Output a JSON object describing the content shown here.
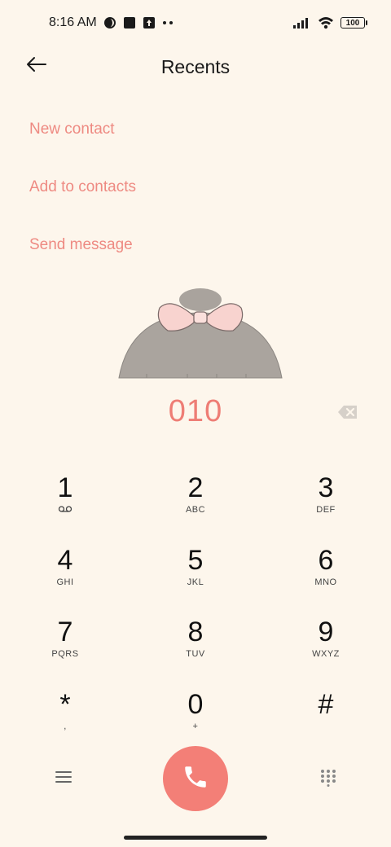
{
  "status_bar": {
    "time": "8:16 AM",
    "battery": "100",
    "icons": [
      "moon-icon",
      "square-icon",
      "upload-icon",
      "dots-icon",
      "signal-icon",
      "wifi-icon",
      "battery-icon"
    ]
  },
  "header": {
    "title": "Recents",
    "back_icon": "arrow-left-icon"
  },
  "actions": {
    "new_contact": "New contact",
    "add_to_contacts": "Add to contacts",
    "send_message": "Send message"
  },
  "dialer": {
    "number": "010",
    "backspace_icon": "backspace-icon"
  },
  "keypad": [
    {
      "digit": "1",
      "letters": ""
    },
    {
      "digit": "2",
      "letters": "ABC"
    },
    {
      "digit": "3",
      "letters": "DEF"
    },
    {
      "digit": "4",
      "letters": "GHI"
    },
    {
      "digit": "5",
      "letters": "JKL"
    },
    {
      "digit": "6",
      "letters": "MNO"
    },
    {
      "digit": "7",
      "letters": "PQRS"
    },
    {
      "digit": "8",
      "letters": "TUV"
    },
    {
      "digit": "9",
      "letters": "WXYZ"
    },
    {
      "digit": "*",
      "letters": ","
    },
    {
      "digit": "0",
      "letters": "+"
    },
    {
      "digit": "#",
      "letters": ""
    }
  ],
  "bottom_bar": {
    "menu_icon": "menu-icon",
    "call_icon": "phone-icon",
    "dialpad_icon": "dialpad-icon"
  },
  "colors": {
    "background": "#fdf6ec",
    "accent": "#ee8a82",
    "call_button": "#f37f77"
  }
}
